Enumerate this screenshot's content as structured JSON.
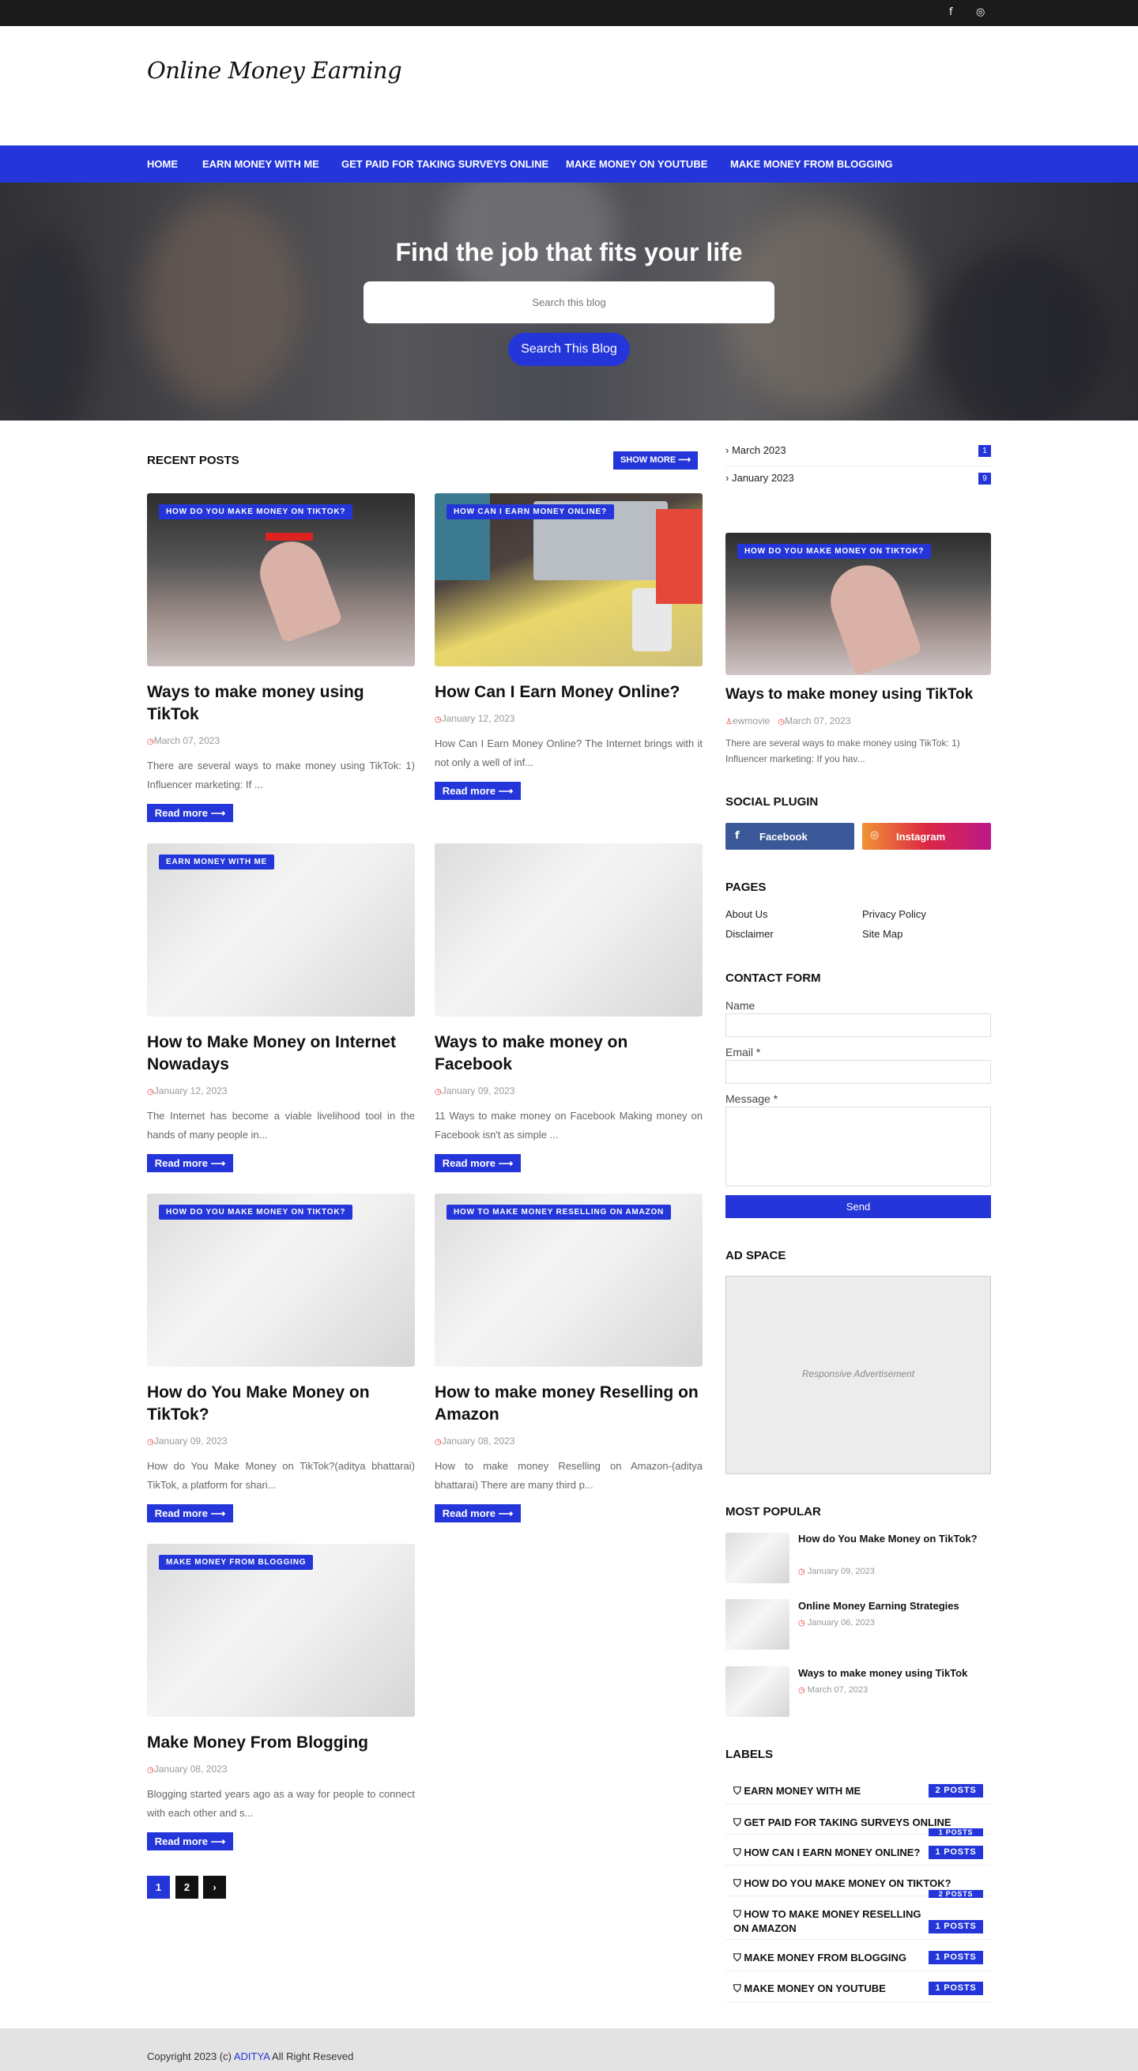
{
  "topbar": {
    "facebook_icon": "f",
    "instagram_icon": "◎"
  },
  "header": {
    "logo": "Online Money Earning"
  },
  "nav": [
    "HOME",
    "EARN MONEY WITH ME",
    "GET PAID FOR TAKING SURVEYS ONLINE",
    "MAKE MONEY ON YOUTUBE",
    "MAKE MONEY FROM BLOGGING"
  ],
  "hero": {
    "title": "Find the job that fits your life",
    "search_placeholder": "Search this blog",
    "search_button": "Search This Blog"
  },
  "recent": {
    "title": "RECENT POSTS",
    "show_more": "SHOW MORE ⟶",
    "read_more": "Read more ⟶",
    "posts": [
      {
        "label": "HOW DO YOU MAKE MONEY ON TIKTOK?",
        "title": "Ways to make money using TikTok",
        "date": "March 07, 2023",
        "snippet": "There are several ways to make money using TikTok: 1) Influencer marketing: If ..."
      },
      {
        "label": "HOW CAN I EARN MONEY ONLINE?",
        "title": "How Can I Earn Money Online?",
        "date": "January 12, 2023",
        "snippet": "How Can I Earn Money Online? The Internet brings with it not only a well of inf..."
      },
      {
        "label": "EARN MONEY WITH ME",
        "title": "How to Make Money on Internet Nowadays",
        "date": "January 12, 2023",
        "snippet": "The Internet has become a viable livelihood tool in the hands of many people in..."
      },
      {
        "label": "",
        "title": "Ways to make money on Facebook",
        "date": "January 09, 2023",
        "snippet": "11 Ways to make money on Facebook Making money on Facebook isn't as simple ..."
      },
      {
        "label": "HOW DO YOU MAKE MONEY ON TIKTOK?",
        "title": "How do You Make Money on TikTok?",
        "date": "January 09, 2023",
        "snippet": "How do You Make Money on TikTok?(aditya bhattarai) TikTok, a platform for shari..."
      },
      {
        "label": "HOW TO MAKE MONEY RESELLING ON AMAZON",
        "title": "How to make money Reselling on Amazon",
        "date": "January 08, 2023",
        "snippet": "How to make money Reselling on Amazon-(aditya bhattarai) There are many third p..."
      },
      {
        "label": "MAKE MONEY FROM BLOGGING",
        "title": "Make Money From Blogging",
        "date": "January 08, 2023",
        "snippet": "Blogging started years ago as a way for people to connect with each other and s..."
      }
    ],
    "pages": [
      "1",
      "2",
      "›"
    ]
  },
  "sidebar": {
    "archive": [
      {
        "name": "March 2023",
        "count": "1"
      },
      {
        "name": "January 2023",
        "count": "9"
      }
    ],
    "featured": {
      "label": "HOW DO YOU MAKE MONEY ON TIKTOK?",
      "title": "Ways to make money using TikTok",
      "author": "ewmovie",
      "date": "March 07, 2023",
      "snippet": "There are several ways to make money using TikTok: 1) Influencer marketing: If you hav..."
    },
    "social": {
      "title": "SOCIAL PLUGIN",
      "facebook": "Facebook",
      "instagram": "Instagram"
    },
    "pages": {
      "title": "PAGES",
      "links": [
        "About Us",
        "Privacy Policy",
        "Disclaimer",
        "Site Map"
      ]
    },
    "contact": {
      "title": "CONTACT FORM",
      "name_label": "Name",
      "email_label": "Email *",
      "message_label": "Message *",
      "send": "Send"
    },
    "ad": {
      "title": "AD SPACE",
      "text": "Responsive Advertisement"
    },
    "popular": {
      "title": "MOST POPULAR",
      "items": [
        {
          "title": "How do You Make Money on TikTok?",
          "date": "January 09, 2023"
        },
        {
          "title": "Online Money Earning Strategies",
          "date": "January 06, 2023"
        },
        {
          "title": "Ways to make money using TikTok",
          "date": "March 07, 2023"
        }
      ]
    },
    "labels": {
      "title": "LABELS",
      "items": [
        {
          "name": "EARN MONEY WITH ME",
          "count": "2 POSTS"
        },
        {
          "name": "GET PAID FOR TAKING SURVEYS ONLINE",
          "count": "1 POSTS"
        },
        {
          "name": "HOW CAN I EARN MONEY ONLINE?",
          "count": "1 POSTS"
        },
        {
          "name": "HOW DO YOU MAKE MONEY ON TIKTOK?",
          "count": "2 POSTS"
        },
        {
          "name": "HOW TO MAKE MONEY RESELLING ON AMAZON",
          "count": "1 POSTS"
        },
        {
          "name": "MAKE MONEY FROM BLOGGING",
          "count": "1 POSTS"
        },
        {
          "name": "MAKE MONEY ON YOUTUBE",
          "count": "1 POSTS"
        }
      ]
    }
  },
  "footer": {
    "prefix": "Copyright 2023 (c) ",
    "link": "ADITYA",
    "suffix": " All Right Reseved"
  },
  "colors": {
    "accent": "#2436d9",
    "topbar": "#1b1b1b",
    "footer": "#e3e3e3"
  }
}
